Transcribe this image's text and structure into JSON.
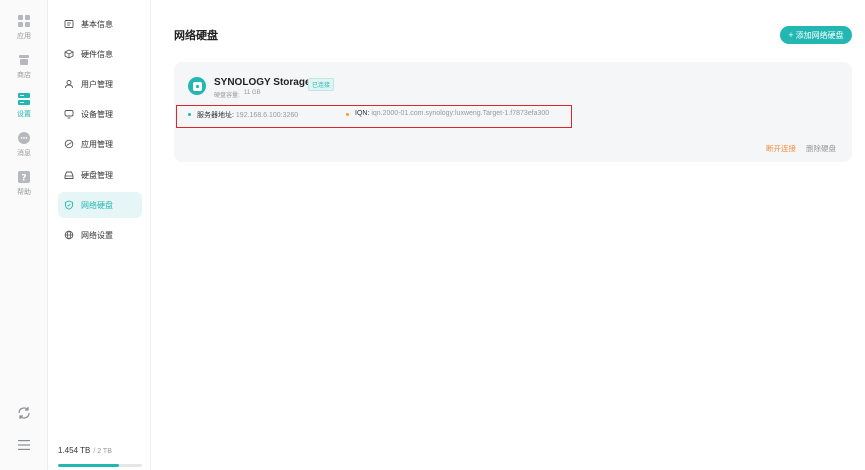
{
  "rail": {
    "items": [
      {
        "label": "应用",
        "icon": "grid-icon"
      },
      {
        "label": "商店",
        "icon": "store-icon"
      },
      {
        "label": "设置",
        "icon": "settings-icon"
      },
      {
        "label": "消息",
        "icon": "message-icon"
      },
      {
        "label": "帮助",
        "icon": "help-icon"
      }
    ],
    "active": "设置"
  },
  "subnav": {
    "items": [
      {
        "label": "基本信息",
        "icon": "info-icon"
      },
      {
        "label": "硬件信息",
        "icon": "cube-icon"
      },
      {
        "label": "用户管理",
        "icon": "user-icon"
      },
      {
        "label": "设备管理",
        "icon": "monitor-icon"
      },
      {
        "label": "应用管理",
        "icon": "app-icon"
      },
      {
        "label": "硬盘管理",
        "icon": "disk-icon"
      },
      {
        "label": "网络硬盘",
        "icon": "shield-icon"
      },
      {
        "label": "网络设置",
        "icon": "globe-icon"
      }
    ],
    "active": "网络硬盘"
  },
  "storage": {
    "used": "1.454 TB",
    "total": "/ 2 TB",
    "fill_fraction": 0.727
  },
  "main": {
    "title": "网络硬盘",
    "add_button": "添加网络硬盘",
    "card": {
      "name": "SYNOLOGY Storage",
      "badge": "已连接",
      "capacity_label": "硬盘容量:",
      "capacity_value": "11 GB",
      "server_label": "服务器地址:",
      "server_value": "192.168.6.100:3260",
      "iqn_label": "IQN:",
      "iqn_value": "iqn.2000-01.com.synology:luxweng.Target-1.f7873efa300",
      "disconnect": "断开连接",
      "delete": "删除硬盘"
    }
  },
  "colors": {
    "accent": "#23b7b4",
    "danger_link": "#f08c3a",
    "highlight_box": "#e0242b",
    "server_dot": "#23b7b4",
    "iqn_dot": "#f0a030"
  }
}
